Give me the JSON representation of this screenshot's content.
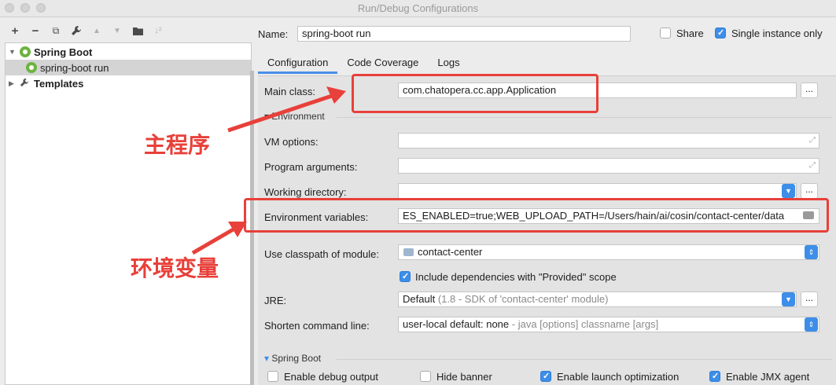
{
  "window": {
    "title": "Run/Debug Configurations"
  },
  "toolbar": {
    "add": "+",
    "remove": "−",
    "copy": "⧉",
    "edit": "🔧",
    "up": "▲",
    "down": "▼",
    "folder": "▣",
    "sort": "↓²"
  },
  "tree": {
    "items": [
      {
        "label": "Spring Boot",
        "expanded": true
      },
      {
        "label": "spring-boot run",
        "selected": true
      },
      {
        "label": "Templates",
        "expanded": false
      }
    ]
  },
  "header": {
    "name_label": "Name:",
    "name_value": "spring-boot run",
    "share_label": "Share",
    "share_checked": false,
    "single_instance_label": "Single instance only",
    "single_instance_checked": true
  },
  "tabs": [
    "Configuration",
    "Code Coverage",
    "Logs"
  ],
  "form": {
    "main_class_label": "Main class:",
    "main_class_value": "com.chatopera.cc.app.Application",
    "environment_section": "Environment",
    "vm_options_label": "VM options:",
    "program_arguments_label": "Program arguments:",
    "working_directory_label": "Working directory:",
    "env_vars_label": "Environment variables:",
    "env_vars_value": "ES_ENABLED=true;WEB_UPLOAD_PATH=/Users/hain/ai/cosin/contact-center/data",
    "classpath_label": "Use classpath of module:",
    "classpath_value": "contact-center",
    "include_deps_label": "Include dependencies with \"Provided\" scope",
    "include_deps_checked": true,
    "jre_label": "JRE:",
    "jre_value_main": "Default",
    "jre_value_detail": " (1.8 - SDK of 'contact-center' module)",
    "shorten_label": "Shorten command line:",
    "shorten_value_main": "user-local default: none",
    "shorten_value_detail": " - java [options] classname [args]",
    "spring_boot_section": "Spring Boot",
    "debug_output_label": "Enable debug output",
    "debug_output_checked": false,
    "hide_banner_label": "Hide banner",
    "hide_banner_checked": false,
    "launch_opt_label": "Enable launch optimization",
    "launch_opt_checked": true,
    "jmx_label": "Enable JMX agent",
    "jmx_checked": true,
    "dots": "..."
  },
  "annotations": {
    "main_program": "主程序",
    "env_vars": "环境变量",
    "color": "#e8403a"
  }
}
